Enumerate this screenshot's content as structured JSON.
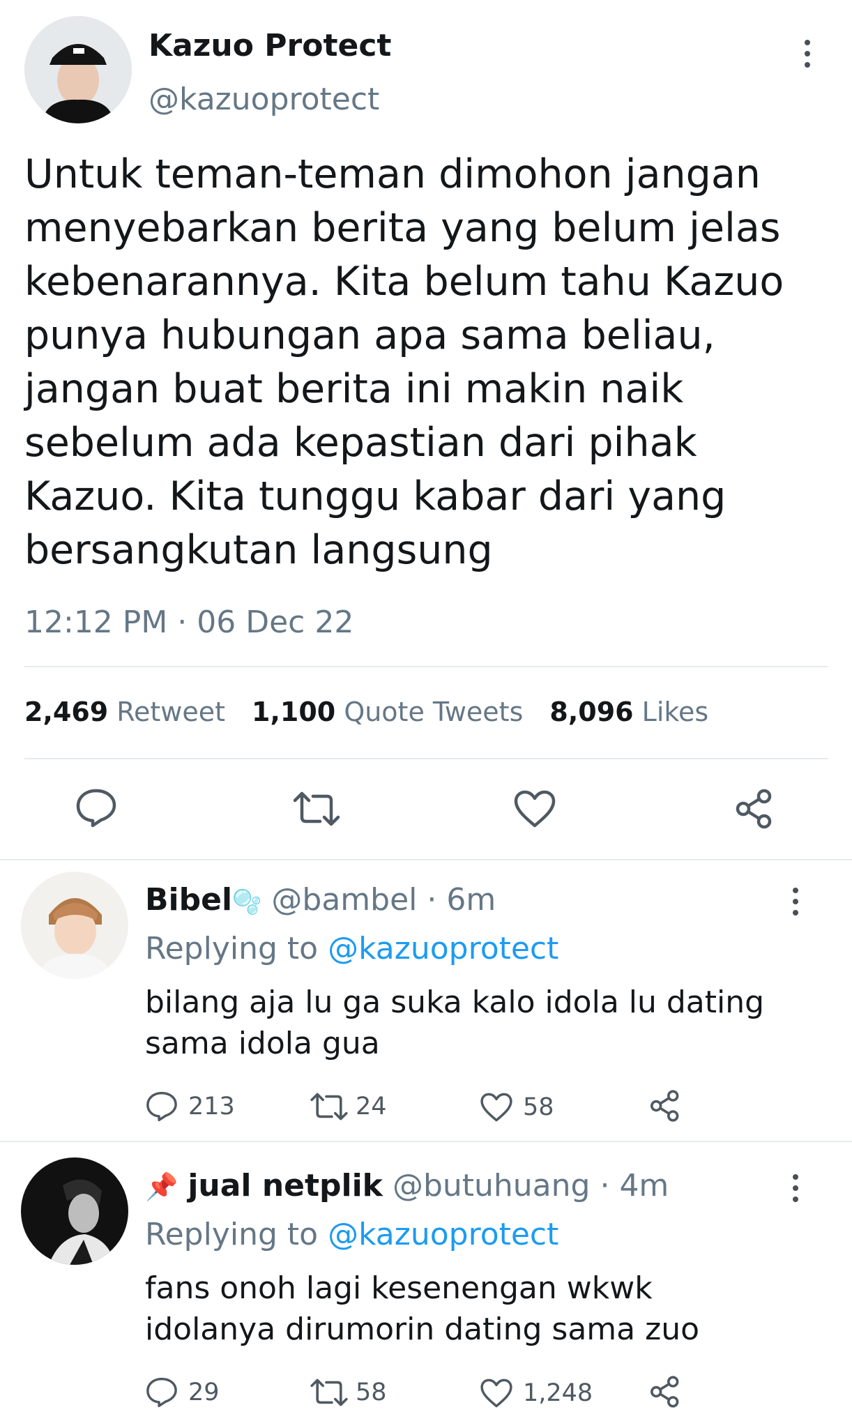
{
  "main_tweet": {
    "display_name": "Kazuo Protect",
    "handle": "@kazuoprotect",
    "text_lines": [
      "Untuk teman-teman dimohon jangan",
      "menyebarkan berita yang belum jelas",
      "kebenarannya. Kita belum tahu Kazuo",
      "punya hubungan apa sama beliau,",
      "jangan buat berita ini makin naik",
      "sebelum ada kepastian dari pihak",
      "Kazuo. Kita tunggu kabar dari yang",
      "bersangkutan langsung"
    ],
    "timestamp": "12:12 PM · 06 Dec 22",
    "stats": {
      "retweet_count": "2,469",
      "retweet_label": "Retweet",
      "quote_count": "1,100",
      "quote_label": "Quote Tweets",
      "likes_count": "8,096",
      "likes_label": "Likes"
    }
  },
  "replies": [
    {
      "display_name": "Bibel",
      "name_emoji": "🫧",
      "handle": "@bambel",
      "time": "· 6m",
      "replying_label": "Replying to",
      "replying_to": "@kazuoprotect",
      "text_lines": [
        "bilang aja lu ga suka kalo idola lu dating",
        "sama idola gua"
      ],
      "reply_count": "213",
      "retweet_count": "24",
      "like_count": "58"
    },
    {
      "display_name": "jual netplik",
      "name_emoji": "📌",
      "handle": "@butuhuang",
      "time": "· 4m",
      "replying_label": "Replying to",
      "replying_to": "@kazuoprotect",
      "text_lines": [
        "fans onoh lagi kesenengan wkwk",
        "idolanya dirumorin dating sama zuo"
      ],
      "reply_count": "29",
      "retweet_count": "58",
      "like_count": "1,248"
    }
  ],
  "colors": {
    "link_blue": "#1d9bf0",
    "secondary_grey": "#657786",
    "text_dark": "#14171a",
    "icon_grey": "#4f5962"
  }
}
